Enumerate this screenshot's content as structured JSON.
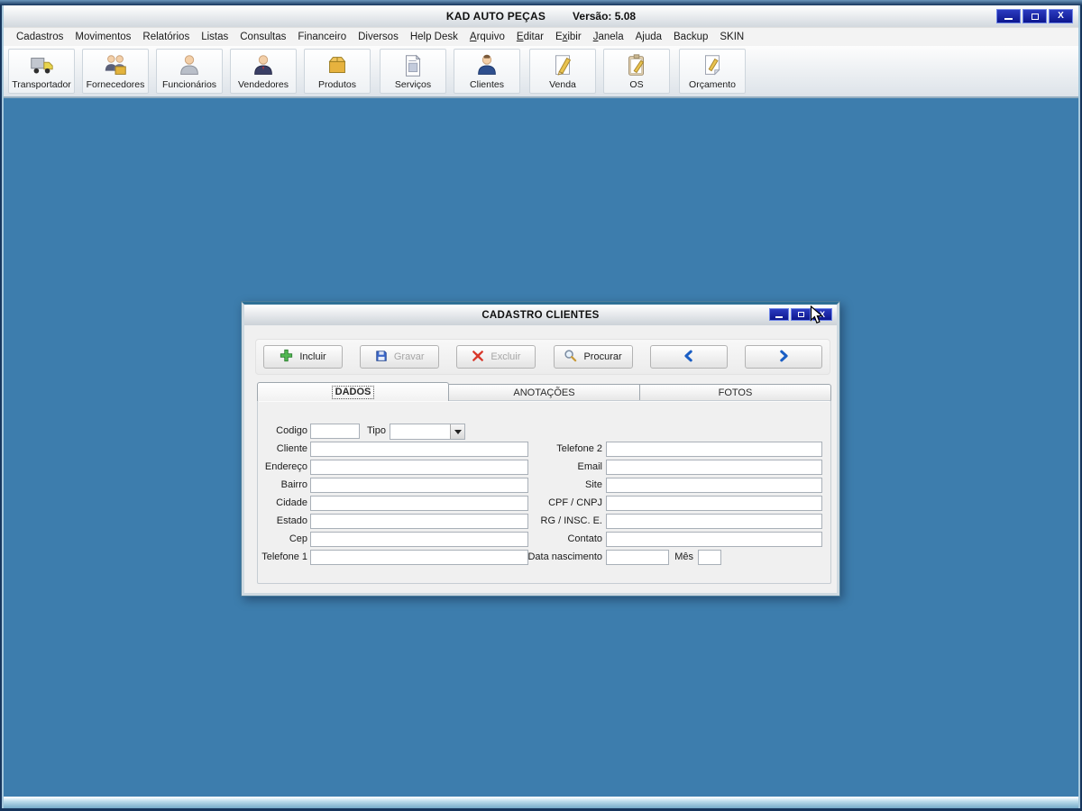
{
  "window": {
    "title": "KAD AUTO PEÇAS",
    "version_label": "Versão: 5.08",
    "close_glyph": "X"
  },
  "menu": {
    "items": [
      {
        "pre": "Cadastros",
        "accel": "",
        "post": ""
      },
      {
        "pre": "Movimentos",
        "accel": "",
        "post": ""
      },
      {
        "pre": "Relatórios",
        "accel": "",
        "post": ""
      },
      {
        "pre": "Listas",
        "accel": "",
        "post": ""
      },
      {
        "pre": "Consultas",
        "accel": "",
        "post": ""
      },
      {
        "pre": "Financeiro",
        "accel": "",
        "post": ""
      },
      {
        "pre": "Diversos",
        "accel": "",
        "post": ""
      },
      {
        "pre": "Help Desk",
        "accel": "",
        "post": ""
      },
      {
        "pre": "",
        "accel": "A",
        "post": "rquivo"
      },
      {
        "pre": "",
        "accel": "E",
        "post": "ditar"
      },
      {
        "pre": "E",
        "accel": "x",
        "post": "ibir"
      },
      {
        "pre": "",
        "accel": "J",
        "post": "anela"
      },
      {
        "pre": "Ajuda",
        "accel": "",
        "post": ""
      },
      {
        "pre": "Backup",
        "accel": "",
        "post": ""
      },
      {
        "pre": "SKIN",
        "accel": "",
        "post": ""
      }
    ]
  },
  "toolbar": {
    "buttons": [
      {
        "label": "Transportador",
        "icon": "truck-icon"
      },
      {
        "label": "Fornecedores",
        "icon": "suppliers-icon"
      },
      {
        "label": "Funcionários",
        "icon": "employee-icon"
      },
      {
        "label": "Vendedores",
        "icon": "salesperson-icon"
      },
      {
        "label": "Produtos",
        "icon": "box-icon"
      },
      {
        "label": "Serviços",
        "icon": "document-icon"
      },
      {
        "label": "Clientes",
        "icon": "client-icon"
      },
      {
        "label": "Venda",
        "icon": "pencil-sheet-icon"
      },
      {
        "label": "OS",
        "icon": "clipboard-pencil-icon"
      },
      {
        "label": "Orçamento",
        "icon": "note-pencil-icon"
      }
    ]
  },
  "dialog": {
    "title": "CADASTRO CLIENTES",
    "close_glyph": "X",
    "actions": [
      {
        "label": "Incluir",
        "enabled": true,
        "icon": "plus-icon"
      },
      {
        "label": "Gravar",
        "enabled": false,
        "icon": "save-icon"
      },
      {
        "label": "Excluir",
        "enabled": false,
        "icon": "delete-x-icon"
      },
      {
        "label": "Procurar",
        "enabled": true,
        "icon": "search-icon"
      },
      {
        "label": "",
        "enabled": true,
        "icon": "prev-arrow-icon"
      },
      {
        "label": "",
        "enabled": true,
        "icon": "next-arrow-icon"
      }
    ],
    "tabs": [
      {
        "label": "DADOS",
        "active": true
      },
      {
        "label": "ANOTAÇÕES",
        "active": false
      },
      {
        "label": "FOTOS",
        "active": false
      }
    ],
    "form": {
      "codigo": {
        "label": "Codigo",
        "value": ""
      },
      "tipo": {
        "label": "Tipo",
        "value": ""
      },
      "left_fields": [
        {
          "label": "Cliente",
          "value": ""
        },
        {
          "label": "Endereço",
          "value": ""
        },
        {
          "label": "Bairro",
          "value": ""
        },
        {
          "label": "Cidade",
          "value": ""
        },
        {
          "label": "Estado",
          "value": ""
        },
        {
          "label": "Cep",
          "value": ""
        },
        {
          "label": "Telefone 1",
          "value": ""
        }
      ],
      "right_fields": [
        {
          "label": "Telefone 2",
          "value": ""
        },
        {
          "label": "Email",
          "value": ""
        },
        {
          "label": "Site",
          "value": ""
        },
        {
          "label": "CPF / CNPJ",
          "value": ""
        },
        {
          "label": "RG / INSC. E.",
          "value": ""
        },
        {
          "label": "Contato",
          "value": ""
        }
      ],
      "data_nascimento": {
        "label": "Data nascimento",
        "value": ""
      },
      "mes": {
        "label": "Mês",
        "value": ""
      }
    }
  },
  "colors": {
    "desktop": "#3d7dad",
    "chrome_navy": "#16355c",
    "control_button_blue": "#101fa6",
    "arrow_blue": "#1a5ec4",
    "disabled_text": "#a6a6a6"
  }
}
